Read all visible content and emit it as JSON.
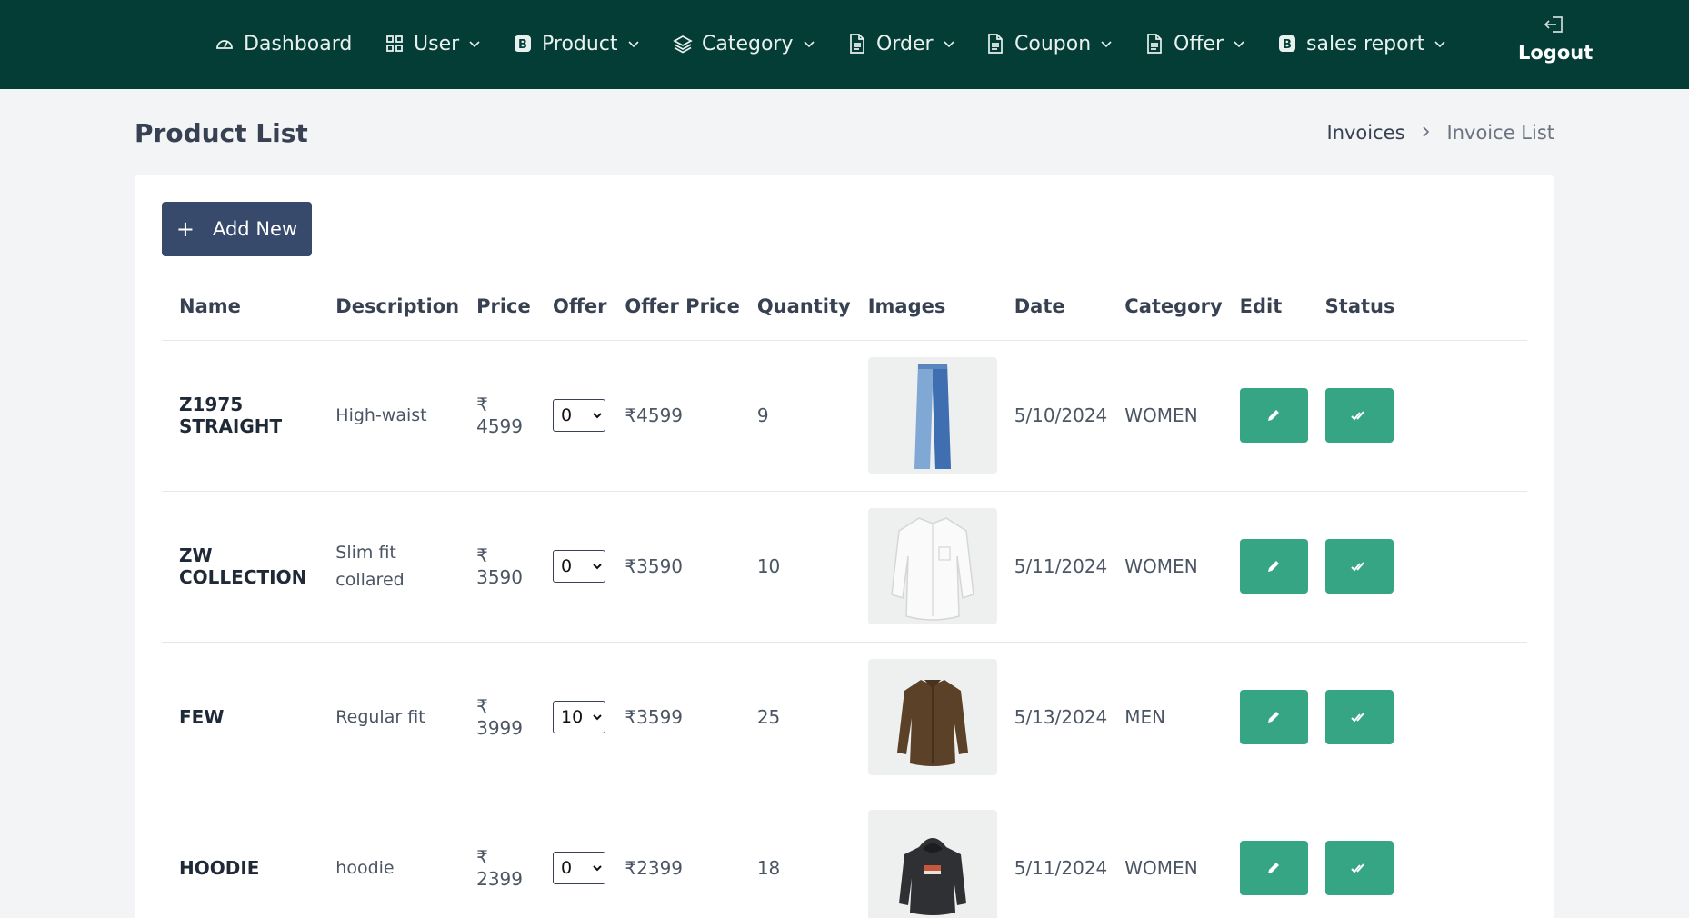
{
  "nav": {
    "items": [
      {
        "label": "Dashboard",
        "icon": "dashboard-icon",
        "has_dropdown": false
      },
      {
        "label": "User",
        "icon": "grid-icon",
        "has_dropdown": true
      },
      {
        "label": "Product",
        "icon": "b-square-icon",
        "has_dropdown": true
      },
      {
        "label": "Category",
        "icon": "layers-icon",
        "has_dropdown": true
      },
      {
        "label": "Order",
        "icon": "document-icon",
        "has_dropdown": true
      },
      {
        "label": "Coupon",
        "icon": "document-icon",
        "has_dropdown": true
      },
      {
        "label": "Offer",
        "icon": "document-icon",
        "has_dropdown": true
      },
      {
        "label": "sales report",
        "icon": "b-square-icon",
        "has_dropdown": true
      }
    ],
    "logout_label": "Logout"
  },
  "page": {
    "title": "Product List",
    "breadcrumb": {
      "first": "Invoices",
      "second": "Invoice List"
    },
    "add_button_label": "Add New"
  },
  "table": {
    "headers": {
      "name": "Name",
      "description": "Description",
      "price": "Price",
      "offer": "Offer",
      "offer_price": "Offer Price",
      "quantity": "Quantity",
      "images": "Images",
      "date": "Date",
      "category": "Category",
      "edit": "Edit",
      "status": "Status"
    },
    "rows": [
      {
        "name": "Z1975 STRAIGHT",
        "description": "High-waist",
        "price": "₹ 4599",
        "offer": "0",
        "offer_price": "₹4599",
        "quantity": "9",
        "image": "jeans-image",
        "date": "5/10/2024",
        "category": "WOMEN"
      },
      {
        "name": "ZW COLLECTION",
        "description": "Slim fit collared",
        "price": "₹ 3590",
        "offer": "0",
        "offer_price": "₹3590",
        "quantity": "10",
        "image": "white-shirt-image",
        "date": "5/11/2024",
        "category": "WOMEN"
      },
      {
        "name": "FEW",
        "description": "Regular fit",
        "price": "₹ 3999",
        "offer": "10",
        "offer_price": "₹3599",
        "quantity": "25",
        "image": "brown-shirt-image",
        "date": "5/13/2024",
        "category": "MEN"
      },
      {
        "name": "HOODIE",
        "description": "hoodie",
        "price": "₹ 2399",
        "offer": "0",
        "offer_price": "₹2399",
        "quantity": "18",
        "image": "hoodie-image",
        "date": "5/11/2024",
        "category": "WOMEN"
      }
    ]
  },
  "colors": {
    "nav_bg": "#033d36",
    "action_btn": "#35a584",
    "add_btn": "#374a6b"
  }
}
